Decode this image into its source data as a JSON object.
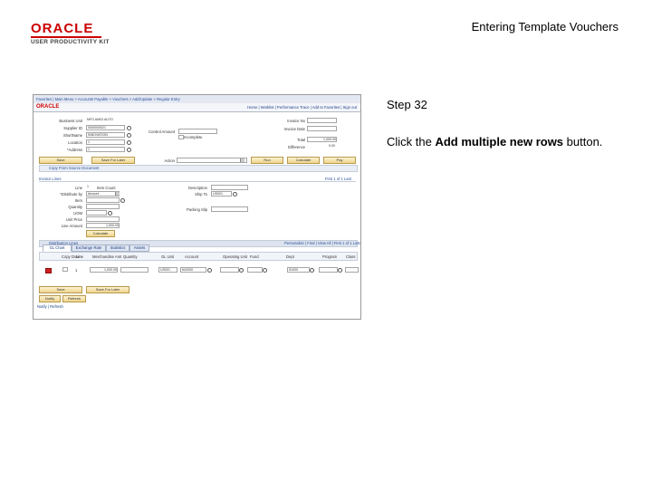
{
  "header": {
    "logo_oracle": "ORACLE",
    "logo_sub": "USER PRODUCTIVITY KIT",
    "title": "Entering Template Vouchers"
  },
  "step": {
    "label": "Step 32",
    "instruction_pre": "Click the ",
    "instruction_bold": "Add multiple new rows",
    "instruction_post": " button."
  },
  "screenshot": {
    "breadcrumb": "Favorites  |  Main Menu  >  Accounts Payable  >  Vouchers  >  Add/Update  >  Regular Entry",
    "brand": "ORACLE",
    "nav_links": "Home  |  Worklist  |  Performance Trace  |  Add to Favorites  |  Sign out",
    "header_fields": {
      "bu_label": "Business Unit",
      "bu_value": "MFG AM03 AUTO",
      "supplier_label": "Supplier ID",
      "supplier_value": "0000000021",
      "shortname_label": "ShortName",
      "shortname_value": "INNOVATION",
      "location_label": "Location",
      "location_value": "1",
      "address_label": "*Address",
      "address_value": "1",
      "invoice_label": "Invoice No",
      "invoice_value": "",
      "invoice_date_label": "Invoice Date",
      "invoice_date_value": "",
      "total_label": "Total",
      "total_value": "1,000.00",
      "difference_label": "Difference",
      "difference_value": "0.00",
      "control_label": "Control Amount",
      "checkbox_label": "Incomplete"
    },
    "buttons": {
      "save": "Save",
      "save_for_later": "Save For Later",
      "action_label": "Action",
      "run": "Run",
      "calculate": "Calculate",
      "pay": "Pay",
      "complete": "Calculate",
      "grid_save": "Save",
      "grid_save_for_later": "Save For Later",
      "notify": "Notify",
      "refresh": "Refresh"
    },
    "copy_band": "Copy From Source Document",
    "invoice_lines_label": "Invoice Lines",
    "invoice_lines_nav": "First  1 of 1  Last",
    "lines": {
      "line_label": "Line",
      "line_value": "1",
      "item_label": "Item Count",
      "distribute_label": "*Distribute by",
      "distribute_value": "Amount",
      "item2_label": "Item",
      "quantity_label": "Quantity",
      "uom_label": "UOM",
      "unit_price_label": "Unit Price",
      "line_amount_label": "Line Amount",
      "line_amount_value": "1,000.00",
      "shipto_label": "Ship To",
      "shipto_value": "US001",
      "itemdesc_label": "Description",
      "packing_label": "Packing Slip",
      "calculate_btn": "Calculate"
    },
    "dist_band": "Distribution Lines",
    "dist_nav": "Personalize | Find | View All | First 1 of 1 Last",
    "tabs": [
      "GL Chart",
      "Exchange Rate",
      "Statistics",
      "Assets"
    ],
    "grid_headers": [
      "Copy Down",
      "Line",
      "Merchandise Amt",
      "Quantity",
      "GL Unit",
      "Account",
      "Operating Unit",
      "Fund",
      "Dept",
      "Program",
      "Class"
    ],
    "grid_row": {
      "line": "1",
      "amount": "1,000.00",
      "gl_unit": "US001",
      "account": "642000",
      "dept": "51000"
    },
    "footer_text": "Notify  |  Refresh"
  }
}
